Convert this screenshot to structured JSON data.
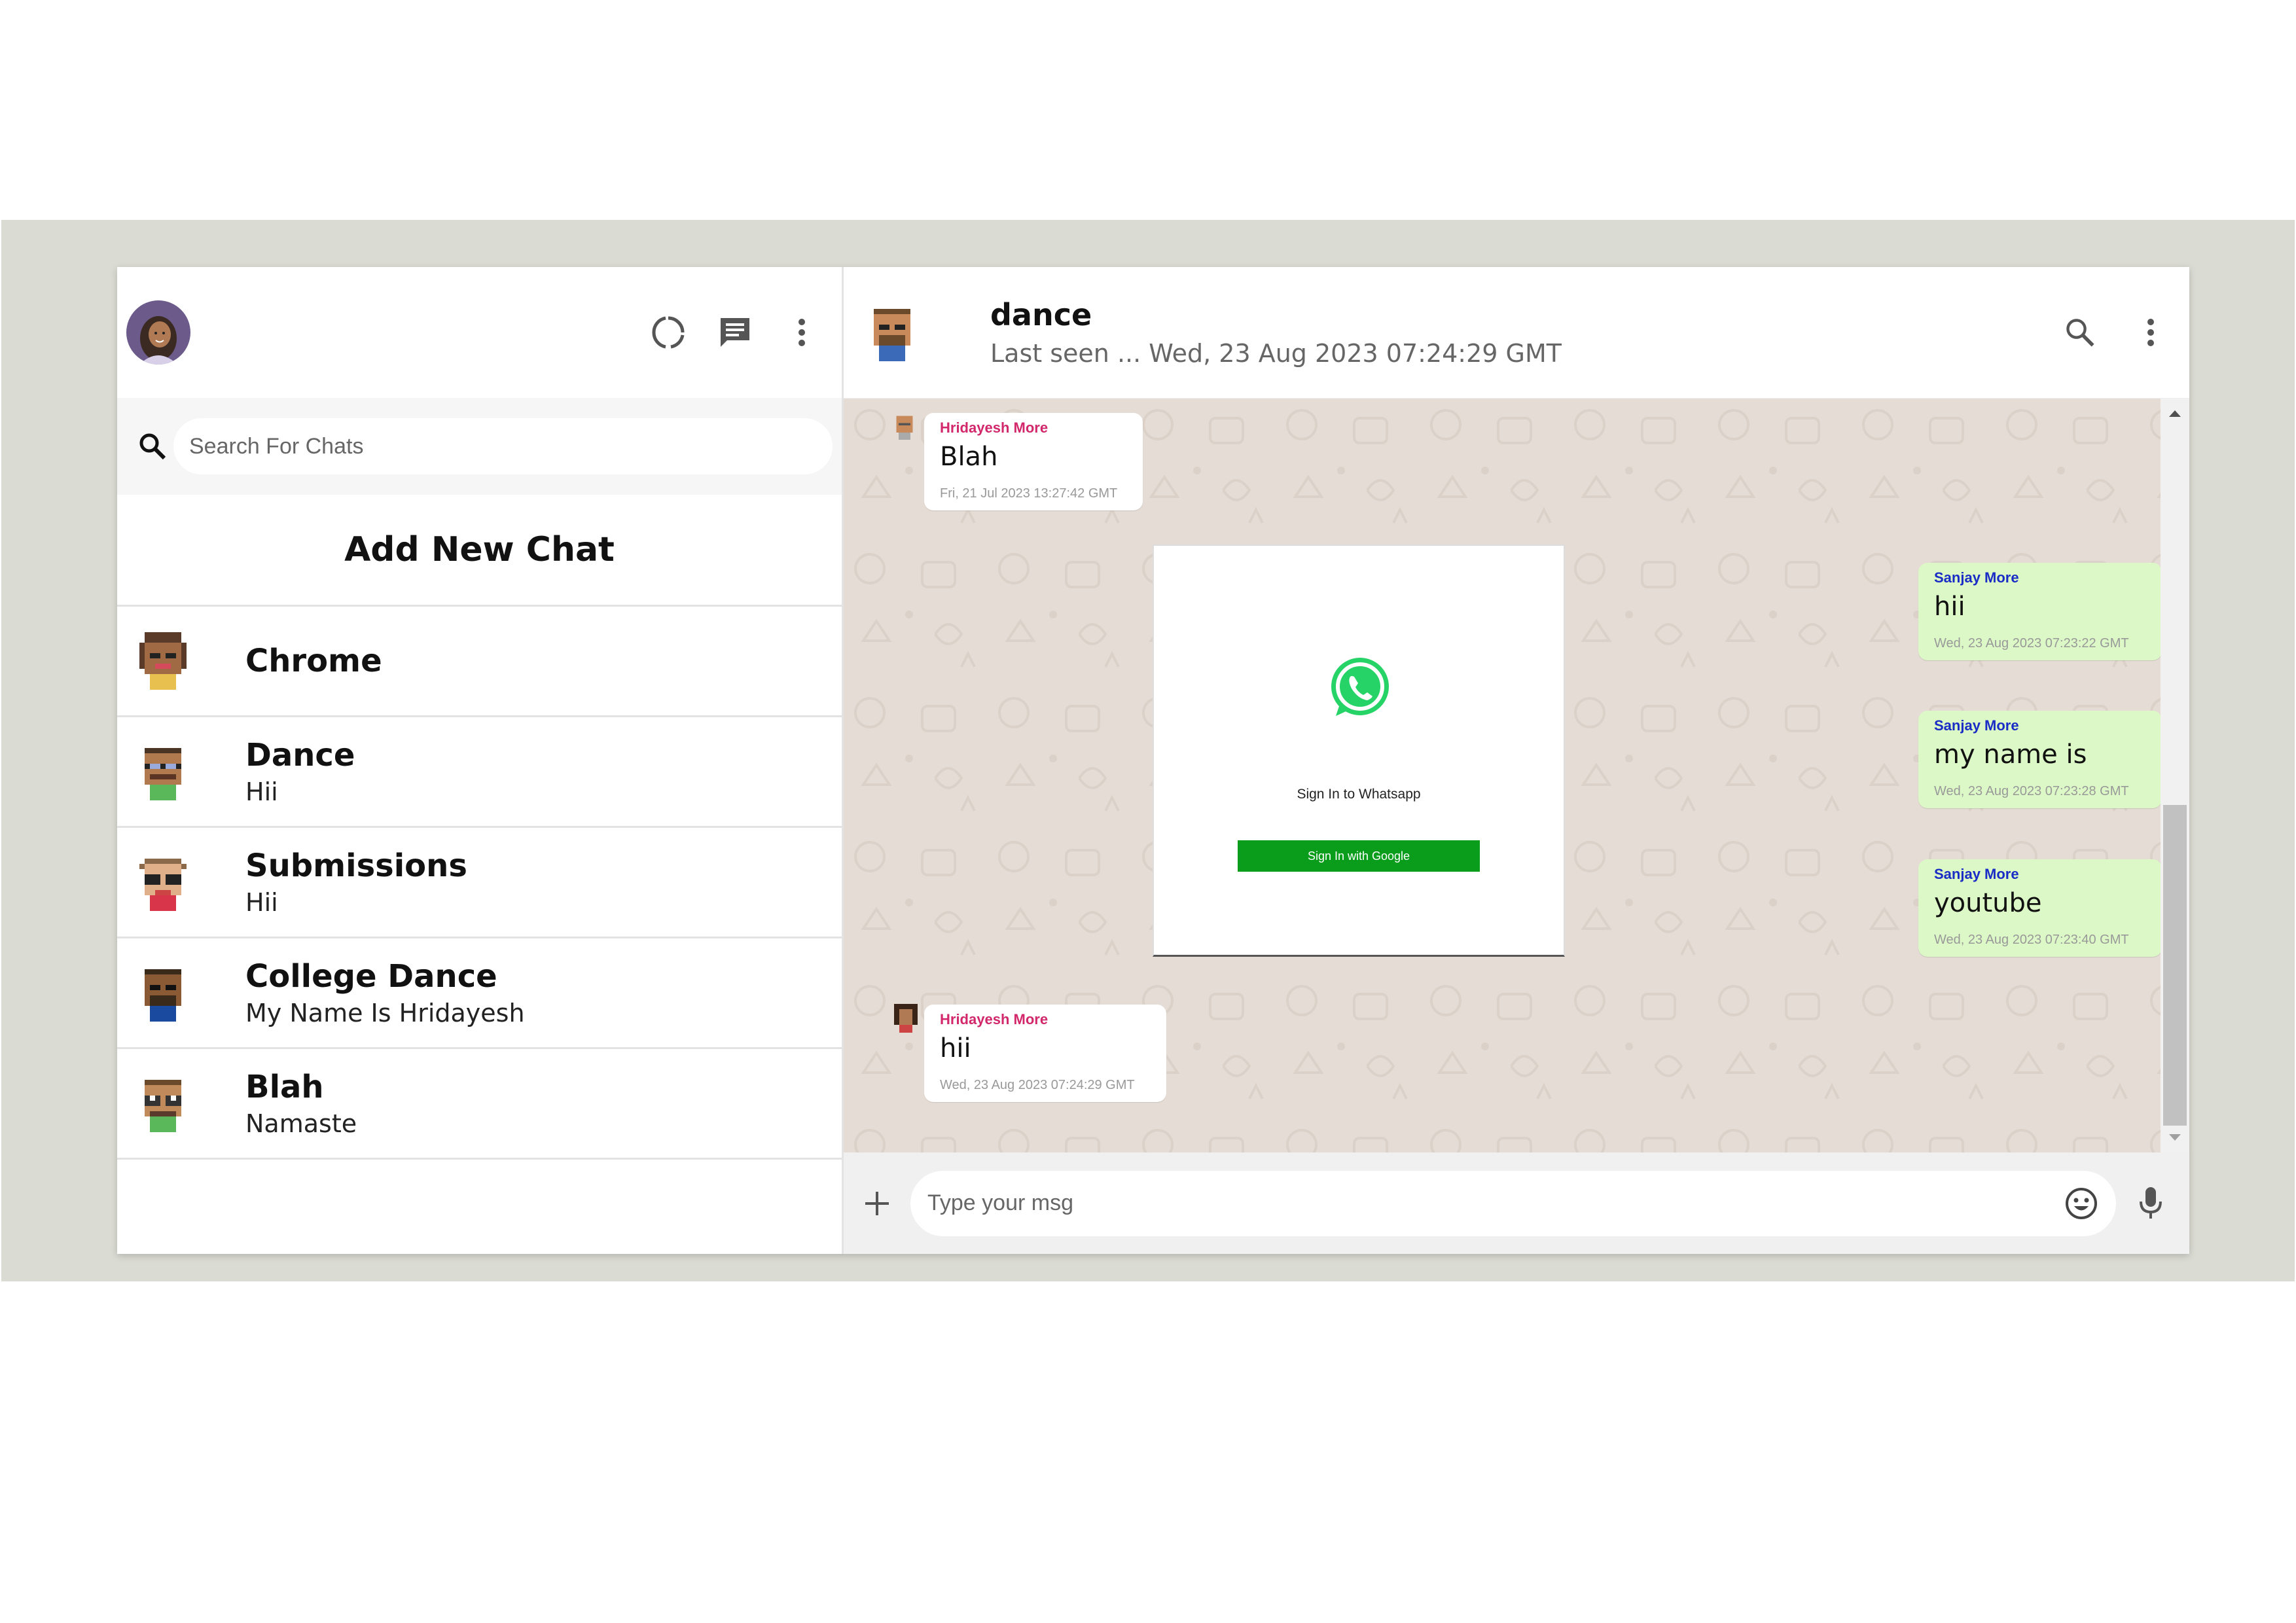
{
  "sidebar": {
    "search_placeholder": "Search For Chats",
    "add_new_label": "Add New Chat",
    "chats": [
      {
        "name": "Chrome",
        "last": ""
      },
      {
        "name": "Dance",
        "last": "Hii"
      },
      {
        "name": "Submissions",
        "last": "Hii"
      },
      {
        "name": "College Dance",
        "last": "My Name Is Hridayesh"
      },
      {
        "name": "Blah",
        "last": "Namaste"
      }
    ],
    "icons": [
      "status-icon",
      "new-chat-icon",
      "menu-icon"
    ]
  },
  "chat": {
    "name": "dance",
    "last_seen": "Last seen ... Wed, 23 Aug 2023 07:24:29 GMT",
    "messages": [
      {
        "author": "Hridayesh More",
        "text": "Blah",
        "time": "Fri, 21 Jul 2023 13:27:42 GMT",
        "side": "received"
      },
      {
        "author": "Sanjay More",
        "text": "hii",
        "time": "Wed, 23 Aug 2023 07:23:22 GMT",
        "side": "sent"
      },
      {
        "author": "Sanjay More",
        "text": "my name is",
        "time": "Wed, 23 Aug 2023 07:23:28 GMT",
        "side": "sent"
      },
      {
        "author": "Sanjay More",
        "text": "youtube",
        "time": "Wed, 23 Aug 2023 07:23:40 GMT",
        "side": "sent"
      },
      {
        "author": "Hridayesh More",
        "text": "hii",
        "time": "Wed, 23 Aug 2023 07:24:29 GMT",
        "side": "received"
      }
    ],
    "image_card": {
      "title": "Sign In to Whatsapp",
      "button": "Sign In with Google"
    },
    "input_placeholder": "Type your msg"
  },
  "colors": {
    "backdrop": "#dadbd3",
    "sent_bubble": "#dcf8c6",
    "received_author": "#d2286b",
    "sent_author": "#1a2cc6",
    "whatsapp_green": "#25d366",
    "google_button": "#0a9c1b"
  }
}
